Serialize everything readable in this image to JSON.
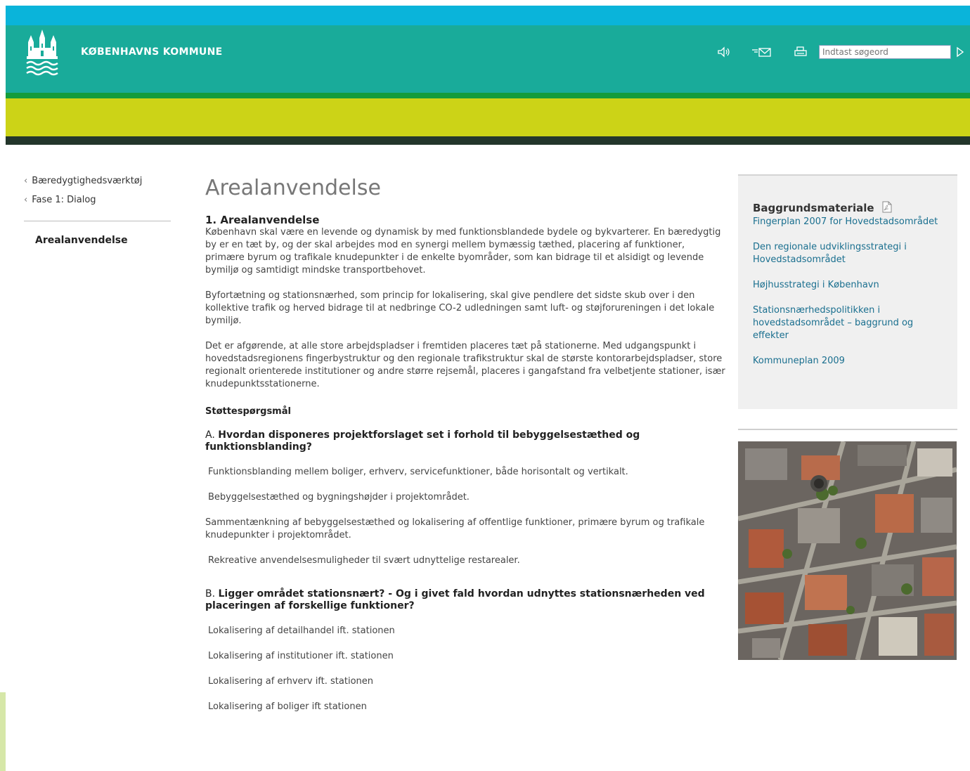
{
  "header": {
    "brand": "KØBENHAVNS KOMMUNE",
    "search_placeholder": "Indtast søgeord",
    "tools": [
      "speaker-icon",
      "mail-icon",
      "print-icon"
    ]
  },
  "nav": {
    "breadcrumbs": [
      {
        "label": "Bæredygtighedsværktøj"
      },
      {
        "label": "Fase 1: Dialog"
      }
    ],
    "current": "Arealanvendelse"
  },
  "main": {
    "title": "Arealanvendelse",
    "section_title": "1. Arealanvendelse",
    "paragraphs": [
      "København skal være en levende og dynamisk by med funktionsblandede bydele og bykvarterer. En bæredygtig by er en tæt by, og der skal arbejdes mod en synergi mellem bymæssig tæthed, placering af funktioner, primære byrum og trafikale knudepunkter i de enkelte byområder, som kan bidrage til et alsidigt og levende bymiljø og samtidigt mindske transportbehovet.",
      "Byfortætning og stationsnærhed, som princip for lokalisering, skal give pendlere det sidste skub over i den kollektive trafik og herved bidrage til at nedbringe CO-2 udledningen samt luft- og støjforureningen i det lokale bymiljø.",
      "Det er afgørende, at alle store arbejdspladser i fremtiden placeres tæt på stationerne. Med udgangspunkt i hovedstadsregionens fingerbystruktur og den regionale trafikstruktur skal de største kontorarbejdspladser, store regionalt orienterede institutioner og andre større rejsemål, placeres i gangafstand fra velbetjente stationer, især knudepunktsstationerne."
    ],
    "support_heading": "Støttespørgsmål",
    "question_a": {
      "prefix": "A. ",
      "text": "Hvordan disponeres projektforslaget set i forhold til bebyggelsestæthed og funktionsblanding?",
      "items": [
        "Funktionsblanding mellem boliger, erhverv, servicefunktioner, både horisontalt og vertikalt.",
        "Bebyggelsestæthed og bygningshøjder i projektområdet.",
        " Sammentænkning af bebyggelsestæthed og lokalisering af offentlige funktioner, primære byrum og trafikale knudepunkter i projektområdet.",
        "Rekreative anvendelsesmuligheder til svært udnyttelige restarealer."
      ]
    },
    "question_b": {
      "prefix": "B. ",
      "text": "Ligger området stationsnært? - Og i givet fald hvordan udnyttes stationsnærheden ved placeringen af forskellige funktioner?",
      "items": [
        "Lokalisering af detailhandel ift. stationen",
        "Lokalisering af institutioner ift. stationen",
        "Lokalisering af erhverv ift. stationen",
        "Lokalisering af boliger ift stationen"
      ]
    }
  },
  "sidebar": {
    "title": "Baggrundsmateriale",
    "links": [
      "Fingerplan 2007 for Hovedstadsområdet",
      "Den regionale udviklingsstrategi i Hovedstadsområdet",
      "Højhusstrategi i København",
      "Stationsnærhedspolitikken i hovedstadsområdet – baggrund og effekter",
      "Kommuneplan 2009"
    ]
  },
  "colors": {
    "topbar": "#0ab4da",
    "header": "#19ab9a",
    "green_line": "#139c3b",
    "lime_band": "#ccd317",
    "dark_line": "#23362b",
    "link": "#1a6f8f"
  }
}
